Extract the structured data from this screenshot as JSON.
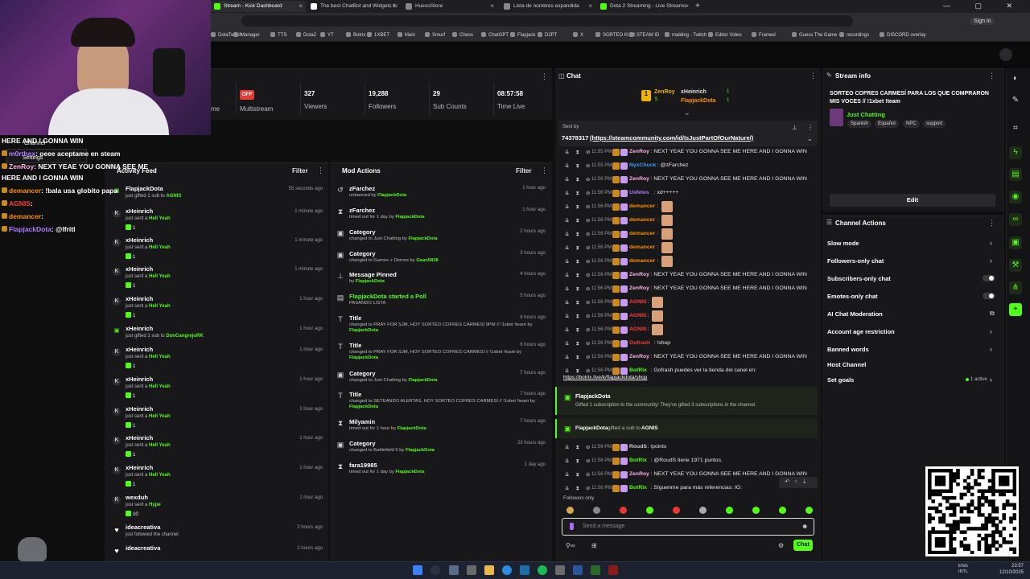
{
  "browser": {
    "tabs": [
      {
        "label": "Stream - Kick Dashboard",
        "active": true
      },
      {
        "label": "The best ChatBot and Widgets fo",
        "active": false
      },
      {
        "label": "HuesoStore",
        "active": false
      },
      {
        "label": "Lista de nombres expandida",
        "active": false
      },
      {
        "label": "Dota 2 Streaming - Live Streams",
        "active": false
      }
    ],
    "window_controls": "— ▢ ✕",
    "bookmarks": [
      "DotaTwitch",
      "Manager",
      "TTS",
      "Dota2",
      "YT",
      "Botrix",
      "1XBET",
      "Main",
      "Smurf",
      "Chess",
      "ChatGPT",
      "Flapjack",
      "D2PT",
      "X",
      "SORTEO KICK",
      "STEAM ID",
      "malding - Twitch",
      "Editor Video",
      "Framed",
      "Guess The Game",
      "recordings",
      "DISCORD overlay"
    ],
    "sign_in": "Sign in"
  },
  "stats": {
    "multistream": {
      "badge": "OFF",
      "label": "Multistream"
    },
    "viewers": {
      "value": "327",
      "label": "Viewers"
    },
    "followers": {
      "value": "19,288",
      "label": "Followers"
    },
    "subs": {
      "value": "29",
      "label": "Sub Counts"
    },
    "time": {
      "value": "08:57:58",
      "label": "Time Live"
    },
    "partial_label": "me"
  },
  "activity_feed": {
    "title": "Activity Feed",
    "filter": "Filter",
    "items": [
      {
        "name": "FlapjackDota",
        "sub": "just gifted 1 sub to",
        "target": "AGNIS",
        "time": "55 seconds ago",
        "icon": "gift",
        "badge": ""
      },
      {
        "name": "xHeinrich",
        "sub": "just sent a",
        "target": "Hell Yeah",
        "time": "1 minute ago",
        "icon": "kick",
        "badge": "1"
      },
      {
        "name": "xHeinrich",
        "sub": "just sent a",
        "target": "Hell Yeah",
        "time": "1 minute ago",
        "icon": "kick",
        "badge": "1"
      },
      {
        "name": "xHeinrich",
        "sub": "just sent a",
        "target": "Hell Yeah",
        "time": "1 minute ago",
        "icon": "kick",
        "badge": "1"
      },
      {
        "name": "xHeinrich",
        "sub": "just sent a",
        "target": "Hell Yeah",
        "time": "1 hour ago",
        "icon": "kick",
        "badge": "1"
      },
      {
        "name": "xHeinrich",
        "sub": "just gifted 1 sub to",
        "target": "DonCangrejoRK",
        "time": "1 hour ago",
        "icon": "gift",
        "badge": ""
      },
      {
        "name": "xHeinrich",
        "sub": "just sent a",
        "target": "Hell Yeah",
        "time": "1 hour ago",
        "icon": "kick",
        "badge": "1"
      },
      {
        "name": "xHeinrich",
        "sub": "just sent a",
        "target": "Hell Yeah",
        "time": "1 hour ago",
        "icon": "kick",
        "badge": "1"
      },
      {
        "name": "xHeinrich",
        "sub": "just sent a",
        "target": "Hell Yeah",
        "time": "1 hour ago",
        "icon": "kick",
        "badge": "1"
      },
      {
        "name": "xHeinrich",
        "sub": "just sent a",
        "target": "Hell Yeah",
        "time": "1 hour ago",
        "icon": "kick",
        "badge": "1"
      },
      {
        "name": "xHeinrich",
        "sub": "just sent a",
        "target": "Hell Yeah",
        "time": "1 hour ago",
        "icon": "kick",
        "badge": "1"
      },
      {
        "name": "wexduh",
        "sub": "just sent a",
        "target": "Hype",
        "time": "1 hour ago",
        "icon": "kick",
        "badge": "10"
      },
      {
        "name": "ideacreativa",
        "sub": "just followed the channel",
        "target": "",
        "time": "2 hours ago",
        "icon": "heart",
        "badge": ""
      },
      {
        "name": "ideacreativa",
        "sub": "",
        "target": "",
        "time": "2 hours ago",
        "icon": "heart",
        "badge": ""
      }
    ]
  },
  "mod_actions": {
    "title": "Mod Actions",
    "filter": "Filter",
    "items": [
      {
        "icon": "↺",
        "title": "zFarchez",
        "sub": "unbanned by",
        "by": "FlapjackDota",
        "time": "1 hour ago"
      },
      {
        "icon": "⧗",
        "title": "zFarchez",
        "sub": "timed out for 1 day by",
        "by": "FlapjackDota",
        "time": "1 hour ago"
      },
      {
        "icon": "▣",
        "title": "Category",
        "sub": "changed to Just Chatting by",
        "by": "FlapjackDota",
        "time": "2 hours ago"
      },
      {
        "icon": "▣",
        "title": "Category",
        "sub": "changed to Games + Demos by",
        "by": "Gean5838",
        "time": "3 hours ago"
      },
      {
        "icon": "⊥",
        "title": "Message Pinned",
        "sub": "by",
        "by": "FlapjackDota",
        "time": "4 hours ago"
      },
      {
        "icon": "▤",
        "title": "FlapjackDota started a Poll",
        "sub": "PASANDO LISTA",
        "by": "",
        "time": "5 hours ago",
        "green": true
      },
      {
        "icon": "T",
        "title": "Title",
        "sub": "changed to PRAY FOR SJM, HOY SORTEO COFRES CARMESÍ 9PM // !1xbet !team by",
        "by": "FlapjackDota",
        "time": "6 hours ago"
      },
      {
        "icon": "T",
        "title": "Title",
        "sub": "changed to PRAY FOR SJM, HOY SORTEO COFRES CARMESÍ // !1xbet !team by",
        "by": "FlapjackDota",
        "time": "6 hours ago"
      },
      {
        "icon": "▣",
        "title": "Category",
        "sub": "changed to Just Chatting by",
        "by": "FlapjackDota",
        "time": "7 hours ago"
      },
      {
        "icon": "T",
        "title": "Title",
        "sub": "changed to SETEANDO ALERTAS, HOY SORTEO COFRES CARMESÍ // !1xbet !team by",
        "by": "FlapjackDota",
        "time": "7 hours ago"
      },
      {
        "icon": "⧗",
        "title": "Milyamin",
        "sub": "timed out for 1 hour by",
        "by": "FlapjackDota",
        "time": "7 hours ago"
      },
      {
        "icon": "▣",
        "title": "Category",
        "sub": "changed to Battlefield 6 by",
        "by": "FlapjackDota",
        "time": "23 hours ago"
      },
      {
        "icon": "⧗",
        "title": "fara19985",
        "sub": "timed out for 1 day by",
        "by": "FlapjackDota",
        "time": "1 day ago"
      }
    ]
  },
  "chat": {
    "title": "Chat",
    "top_users": [
      {
        "name": "ZenRoy",
        "score": "5"
      },
      {
        "name": "xHeinrich",
        "score": "1"
      },
      {
        "name": "FlapjackDota",
        "score": "1"
      }
    ],
    "pinned": {
      "sent_by": "Sent by",
      "text": "74378317",
      "link": "(https://steamcommunity.com/id/IsJustPartOfOurNature/)"
    },
    "messages": [
      {
        "time": "11:55 PM",
        "name": "ZenRoy",
        "color": "#ffb0e8",
        "text": ": NEXT YEAE YOU GONNA SEE ME HERE AND I GONNA WIN"
      },
      {
        "time": "11:55 PM",
        "name": "NyxChuck",
        "color": "#3aa0ff",
        "text": ": @zFarchez"
      },
      {
        "time": "11:56 PM",
        "name": "ZenRoy",
        "color": "#ffb0e8",
        "text": ": NEXT YEAE YOU GONNA SEE ME HERE AND I GONNA WIN"
      },
      {
        "time": "11:56 PM",
        "name": "Usfetes",
        "color": "#b07cff",
        "text": ": xd+++++"
      },
      {
        "time": "11:56 PM",
        "name": "demancer",
        "color": "#ff8c00",
        "text": ":",
        "emote": true
      },
      {
        "time": "11:56 PM",
        "name": "demancer",
        "color": "#ff8c00",
        "text": ":",
        "emote": true
      },
      {
        "time": "11:56 PM",
        "name": "demancer",
        "color": "#ff8c00",
        "text": ":",
        "emote": true
      },
      {
        "time": "11:56 PM",
        "name": "demancer",
        "color": "#ff8c00",
        "text": ":",
        "emote": true
      },
      {
        "time": "11:56 PM",
        "name": "demancer",
        "color": "#ff8c00",
        "text": ":",
        "emote": true
      },
      {
        "time": "11:56 PM",
        "name": "ZenRoy",
        "color": "#ffb0e8",
        "text": ": NEXT YEAE YOU GONNA SEE ME HERE AND I GONNA WIN"
      },
      {
        "time": "11:56 PM",
        "name": "ZenRoy",
        "color": "#ffb0e8",
        "text": ": NEXT YEAE YOU GONNA SEE ME HERE AND I GONNA WIN"
      },
      {
        "time": "11:56 PM",
        "name": "AGNIS",
        "color": "#ff3b3b",
        "text": ":",
        "emote": true
      },
      {
        "time": "11:56 PM",
        "name": "AGNIS",
        "color": "#ff3b3b",
        "text": ":",
        "emote": true
      },
      {
        "time": "11:56 PM",
        "name": "AGNIS",
        "color": "#ff3b3b",
        "text": ":",
        "emote": true
      },
      {
        "time": "11:56 PM",
        "name": "Gofrash",
        "color": "#ff3b3b",
        "text": ": !shop"
      },
      {
        "time": "11:56 PM",
        "name": "ZenRoy",
        "color": "#ffb0e8",
        "text": ": NEXT YEAE YOU GONNA SEE ME HERE AND I GONNA WIN"
      },
      {
        "time": "11:56 PM",
        "name": "BotRix",
        "color": "#53fc18",
        "text": ": Gofrash puedes ver la tienda del canel en:"
      }
    ],
    "shop_link": "https://botrix.live/k/flapjackdota/shop",
    "gift_event": {
      "name": "FlapjackDota",
      "text": "Gifted 1 subscription to the community! They've gifted 3 subscriptions in the channel."
    },
    "gift_sub": {
      "name": "FlapjackDota",
      "text": "gifted a sub to",
      "target": "AGNIS"
    },
    "messages2": [
      {
        "time": "11:56 PM",
        "name": "RoudS",
        "color": "#cfcfcf",
        "text": ": !points"
      },
      {
        "time": "11:56 PM",
        "name": "BotRix",
        "color": "#53fc18",
        "text": ": @RoudS tiene 1971 puntos."
      },
      {
        "time": "11:56 PM",
        "name": "ZenRoy",
        "color": "#ffb0e8",
        "text": ": NEXT YEAE YOU GONNA SEE ME HERE AND I GONNA WIN"
      },
      {
        "time": "11:56 PM",
        "name": "BotRix",
        "color": "#53fc18",
        "text": ": Síguenme para más referencias: IG:"
      }
    ],
    "followers_only": "Followers only",
    "input_placeholder": "Send a message",
    "send_button": "Chat"
  },
  "stream_info": {
    "title": "Stream info",
    "stream_title": "SORTEO COFRES CARMESÍ PARA LOS QUE COMPRARON MIS VOCES // !1xbet !team",
    "category": "Just Chatting",
    "tags": [
      "Spanish",
      "Español",
      "NPC",
      "support"
    ],
    "edit_button": "Edit"
  },
  "channel_actions": {
    "title": "Channel Actions",
    "items": [
      {
        "label": "Slow mode",
        "control": "chevron"
      },
      {
        "label": "Followers-only chat",
        "control": "chevron"
      },
      {
        "label": "Subscribers-only chat",
        "control": "toggle"
      },
      {
        "label": "Emotes-only chat",
        "control": "toggle"
      },
      {
        "label": "AI Chat Moderation",
        "control": "external"
      },
      {
        "label": "Account age restriction",
        "control": "chevron"
      },
      {
        "label": "Banned words",
        "control": "chevron"
      },
      {
        "label": "Host Channel",
        "control": "none"
      },
      {
        "label": "Set goals",
        "control": "active",
        "status": "1 active"
      }
    ]
  },
  "overlay_chat": [
    {
      "name": "",
      "color": "#fff",
      "text": "HERE AND I GONNA WIN"
    },
    {
      "name": "m0rthex",
      "color": "#b07cff",
      "text": ": oeee aceptame en steam"
    },
    {
      "name": "ZenRoy",
      "color": "#ffb0e8",
      "text": ": NEXT YEAE YOU GONNA SEE ME"
    },
    {
      "name": "",
      "color": "#fff",
      "text": "HERE AND I GONNA WIN"
    },
    {
      "name": "demancer",
      "color": "#ff8c00",
      "text": ": !bala usa globito papa"
    },
    {
      "name": "AGNIS",
      "color": "#ff3b3b",
      "text": ":"
    },
    {
      "name": "demancer",
      "color": "#ff8c00",
      "text": ":"
    },
    {
      "name": "FlapjackDota",
      "color": "#b07cff",
      "text": ": @lfritl"
    }
  ],
  "overlay_menu": {
    "item1": "Channel",
    "item2": "Settings"
  },
  "taskbar": {
    "lang": "ENG INTL",
    "time": "23:57",
    "date": "12/10/2025"
  },
  "colors": {
    "accent": "#53fc18",
    "panel": "#18181b",
    "bg": "#0f0f10"
  }
}
